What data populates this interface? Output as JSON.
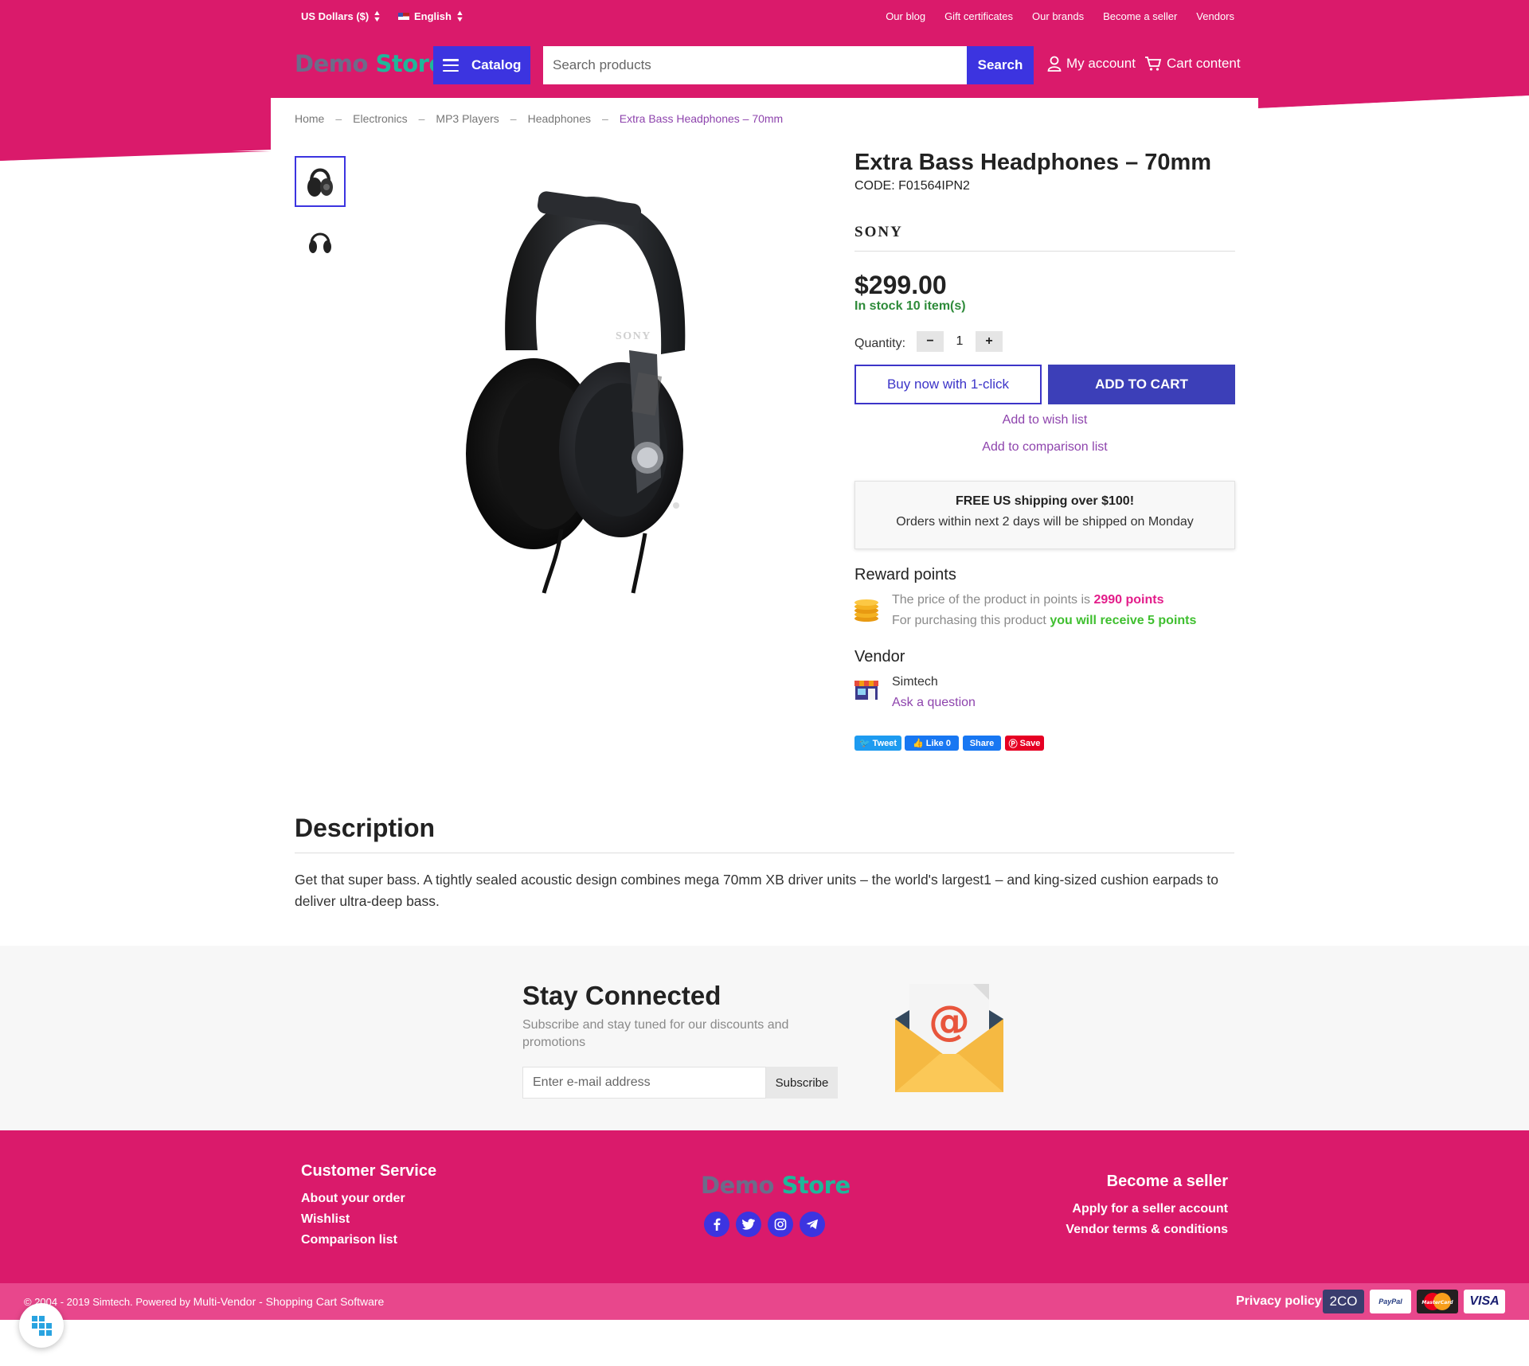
{
  "topbar": {
    "currency": "US Dollars ($)",
    "language": "English",
    "links": [
      "Our blog",
      "Gift certificates",
      "Our brands",
      "Become a seller",
      "Vendors"
    ]
  },
  "header": {
    "logo_part1": "Demo",
    "logo_part2": "Store",
    "catalog_label": "Catalog",
    "search_placeholder": "Search products",
    "search_button": "Search",
    "account_label": "My account",
    "cart_label": "Cart content"
  },
  "breadcrumb": [
    "Home",
    "Electronics",
    "MP3 Players",
    "Headphones",
    "Extra Bass Headphones – 70mm"
  ],
  "product": {
    "title": "Extra Bass Headphones – 70mm",
    "code": "CODE: F01564IPN2",
    "brand": "SONY",
    "image_brand_text": "SONY",
    "price": "$299.00",
    "stock": "In stock 10 item(s)",
    "quantity_label": "Quantity:",
    "quantity_minus": "−",
    "quantity_value": "1",
    "quantity_plus": "+",
    "buy_one_click": "Buy now with 1-click",
    "add_to_cart": "ADD TO CART",
    "add_wishlist": "Add to wish list",
    "add_comparison": "Add to comparison list"
  },
  "shipping": {
    "title": "FREE US shipping over $100!",
    "text": "Orders within next 2 days will be shipped on Monday"
  },
  "reward": {
    "heading": "Reward points",
    "line1_prefix": "The price of the product in points is ",
    "line1_value": "2990 points",
    "line2_prefix": "For purchasing this product ",
    "line2_value": "you will receive 5 points"
  },
  "vendor": {
    "heading": "Vendor",
    "name": "Simtech",
    "ask": "Ask a question"
  },
  "share": {
    "tweet": "Tweet",
    "like": "Like 0",
    "share": "Share",
    "save": "Save"
  },
  "description": {
    "heading": "Description",
    "text": "Get that super bass. A tightly sealed acoustic design combines mega 70mm XB driver units – the world's largest1 – and king-sized cushion earpads to deliver ultra-deep bass."
  },
  "newsletter": {
    "heading": "Stay Connected",
    "text": "Subscribe and stay tuned for our discounts and promotions",
    "placeholder": "Enter e-mail address",
    "button": "Subscribe"
  },
  "footer": {
    "customer_service": {
      "heading": "Customer Service",
      "links": [
        "About your order",
        "Wishlist",
        "Comparison list"
      ]
    },
    "seller": {
      "heading": "Become a seller",
      "links": [
        "Apply for a seller account",
        "Vendor terms & conditions"
      ]
    },
    "social_icons": [
      "facebook-icon",
      "twitter-icon",
      "instagram-icon",
      "telegram-icon"
    ],
    "copyright": "© 2004 - 2019 Simtech.  Powered by ",
    "powered_link": "Multi-Vendor - Shopping Cart Software",
    "privacy": "Privacy policy",
    "payments": [
      "2CO",
      "PayPal",
      "MasterCard",
      "VISA"
    ]
  },
  "colors": {
    "brand_pink": "#da1a6b",
    "accent_blue": "#3c34e0",
    "link_purple": "#8e44ad",
    "stock_green": "#2e8b3a"
  }
}
